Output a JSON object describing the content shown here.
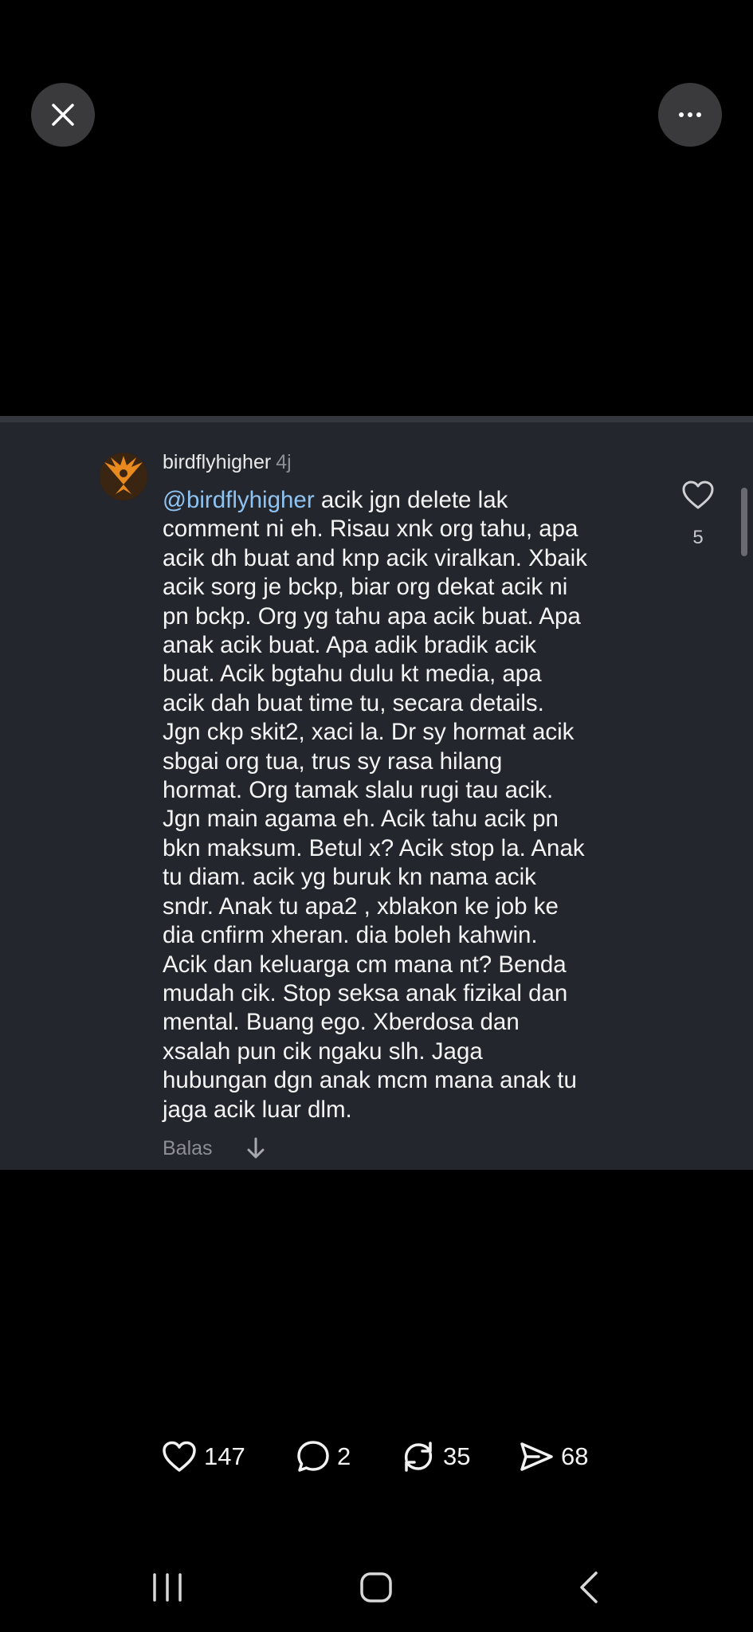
{
  "top_bar": {
    "close_icon": "close-icon",
    "more_icon": "more-horizontal-icon"
  },
  "comment": {
    "username": "birdflyhigher",
    "time": "4j",
    "mention": "@birdflyhigher",
    "text": " acik jgn delete lak\ncomment ni eh. Risau xnk org tahu, apa\nacik dh buat and knp acik viralkan. Xbaik\nacik sorg je bckp, biar org dekat acik ni\npn bckp. Org yg tahu apa acik buat. Apa\nanak acik buat. Apa adik bradik acik\nbuat. Acik bgtahu dulu kt media, apa\nacik dah buat time tu, secara details.\nJgn ckp skit2, xaci la. Dr sy hormat acik\nsbgai org tua, trus sy rasa hilang\nhormat. Org tamak slalu rugi tau acik.\nJgn main agama eh. Acik tahu acik pn\nbkn maksum. Betul x? Acik stop la. Anak\ntu diam. acik yg buruk kn nama acik\nsndr. Anak tu apa2 , xblakon ke job ke\ndia cnfirm xheran. dia boleh kahwin.\nAcik dan keluarga cm mana nt? Benda\nmudah cik. Stop seksa anak fizikal dan\nmental. Buang ego. Xberdosa dan\nxsalah pun cik ngaku slh. Jaga\nhubungan dgn anak mcm mana anak tu\njaga acik luar dlm.",
    "reply_label": "Balas",
    "like_count": "5"
  },
  "actions": {
    "likes": "147",
    "comments": "2",
    "reposts": "35",
    "shares": "68"
  },
  "colors": {
    "background": "#000000",
    "card": "#24262d",
    "mention": "#8fc3f2",
    "muted": "#8e8f95"
  }
}
